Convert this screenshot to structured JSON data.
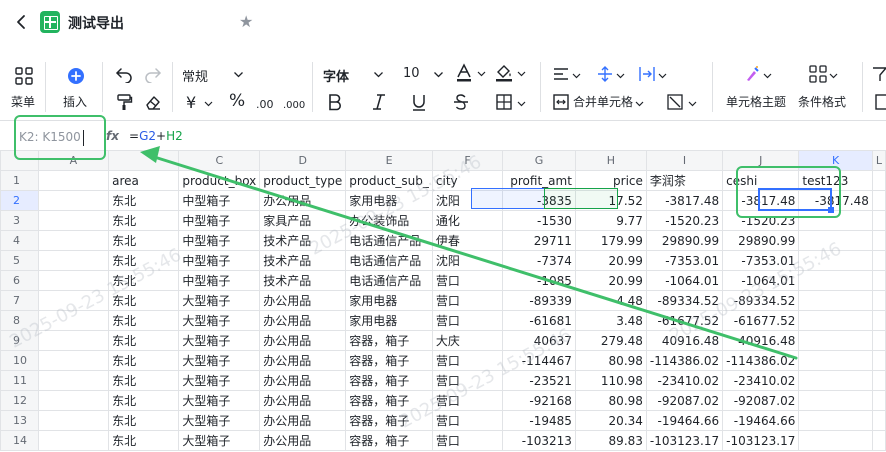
{
  "title_bar": {
    "doc_title": "测试导出"
  },
  "toolbar": {
    "menu_label": "菜单",
    "insert_label": "插入",
    "number_format": "常规",
    "font_name": "字体",
    "font_size": "10",
    "merge_label": "合并单元格",
    "cell_theme_label": "单元格主题",
    "cond_format_label": "条件格式",
    "percent_symbol": "%",
    "currency_symbol": "¥"
  },
  "formula_bar": {
    "name_box": "K2: K1500",
    "fx": "fx",
    "formula_prefix": "=",
    "ref1": "G2",
    "op": "+",
    "ref2": "H2"
  },
  "sheet": {
    "columns": [
      "A",
      "B",
      "C",
      "D",
      "E",
      "F",
      "G",
      "H",
      "I",
      "J",
      "K",
      "L"
    ],
    "headers": {
      "B": "area",
      "C": "product_box",
      "D": "product_type",
      "E": "product_sub_",
      "F": "city",
      "G": "profit_amt",
      "H": "price",
      "I": "李润茶",
      "J": "ceshi",
      "K": "test123"
    },
    "rows": [
      {
        "n": "1",
        "B": "area",
        "C": "product_box",
        "D": "product_type",
        "E": "product_sub_",
        "F": "city",
        "G": "profit_amt",
        "H": "price",
        "I": "李润茶",
        "J": "ceshi",
        "K": "test123"
      },
      {
        "n": "2",
        "B": "东北",
        "C": "中型箱子",
        "D": "办公用品",
        "E": "家用电器",
        "F": "沈阳",
        "G": "-3835",
        "H": "17.52",
        "I": "-3817.48",
        "J": "-3817.48",
        "K": "-3817.48"
      },
      {
        "n": "3",
        "B": "东北",
        "C": "中型箱子",
        "D": "家具产品",
        "E": "办公装饰品",
        "F": "通化",
        "G": "-1530",
        "H": "9.77",
        "I": "-1520.23",
        "J": "-1520.23",
        "K": ""
      },
      {
        "n": "4",
        "B": "东北",
        "C": "中型箱子",
        "D": "技术产品",
        "E": "电话通信产品",
        "F": "伊春",
        "G": "29711",
        "H": "179.99",
        "I": "29890.99",
        "J": "29890.99",
        "K": ""
      },
      {
        "n": "5",
        "B": "东北",
        "C": "中型箱子",
        "D": "技术产品",
        "E": "电话通信产品",
        "F": "沈阳",
        "G": "-7374",
        "H": "20.99",
        "I": "-7353.01",
        "J": "-7353.01",
        "K": ""
      },
      {
        "n": "6",
        "B": "东北",
        "C": "中型箱子",
        "D": "技术产品",
        "E": "电话通信产品",
        "F": "营口",
        "G": "-1085",
        "H": "20.99",
        "I": "-1064.01",
        "J": "-1064.01",
        "K": ""
      },
      {
        "n": "7",
        "B": "东北",
        "C": "大型箱子",
        "D": "办公用品",
        "E": "家用电器",
        "F": "营口",
        "G": "-89339",
        "H": "4.48",
        "I": "-89334.52",
        "J": "-89334.52",
        "K": ""
      },
      {
        "n": "8",
        "B": "东北",
        "C": "大型箱子",
        "D": "办公用品",
        "E": "家用电器",
        "F": "营口",
        "G": "-61681",
        "H": "3.48",
        "I": "-61677.52",
        "J": "-61677.52",
        "K": ""
      },
      {
        "n": "9",
        "B": "东北",
        "C": "大型箱子",
        "D": "办公用品",
        "E": "容器，箱子",
        "F": "大庆",
        "G": "40637",
        "H": "279.48",
        "I": "40916.48",
        "J": "40916.48",
        "K": ""
      },
      {
        "n": "10",
        "B": "东北",
        "C": "大型箱子",
        "D": "办公用品",
        "E": "容器，箱子",
        "F": "营口",
        "G": "-114467",
        "H": "80.98",
        "I": "-114386.02",
        "J": "-114386.02",
        "K": ""
      },
      {
        "n": "11",
        "B": "东北",
        "C": "大型箱子",
        "D": "办公用品",
        "E": "容器，箱子",
        "F": "营口",
        "G": "-23521",
        "H": "110.98",
        "I": "-23410.02",
        "J": "-23410.02",
        "K": ""
      },
      {
        "n": "12",
        "B": "东北",
        "C": "大型箱子",
        "D": "办公用品",
        "E": "容器，箱子",
        "F": "营口",
        "G": "-92168",
        "H": "80.98",
        "I": "-92087.02",
        "J": "-92087.02",
        "K": ""
      },
      {
        "n": "13",
        "B": "东北",
        "C": "大型箱子",
        "D": "办公用品",
        "E": "容器，箱子",
        "F": "营口",
        "G": "-19485",
        "H": "20.34",
        "I": "-19464.66",
        "J": "-19464.66",
        "K": ""
      },
      {
        "n": "14",
        "B": "东北",
        "C": "大型箱子",
        "D": "办公用品",
        "E": "容器，箱子",
        "F": "营口",
        "G": "-103213",
        "H": "89.83",
        "I": "-103123.17",
        "J": "-103123.17",
        "K": ""
      }
    ]
  },
  "watermark_text": "2025-09-23 15:55:46",
  "colors": {
    "accent": "#3370ff",
    "annotation": "#3fbf6a",
    "logo": "#22b35e"
  }
}
